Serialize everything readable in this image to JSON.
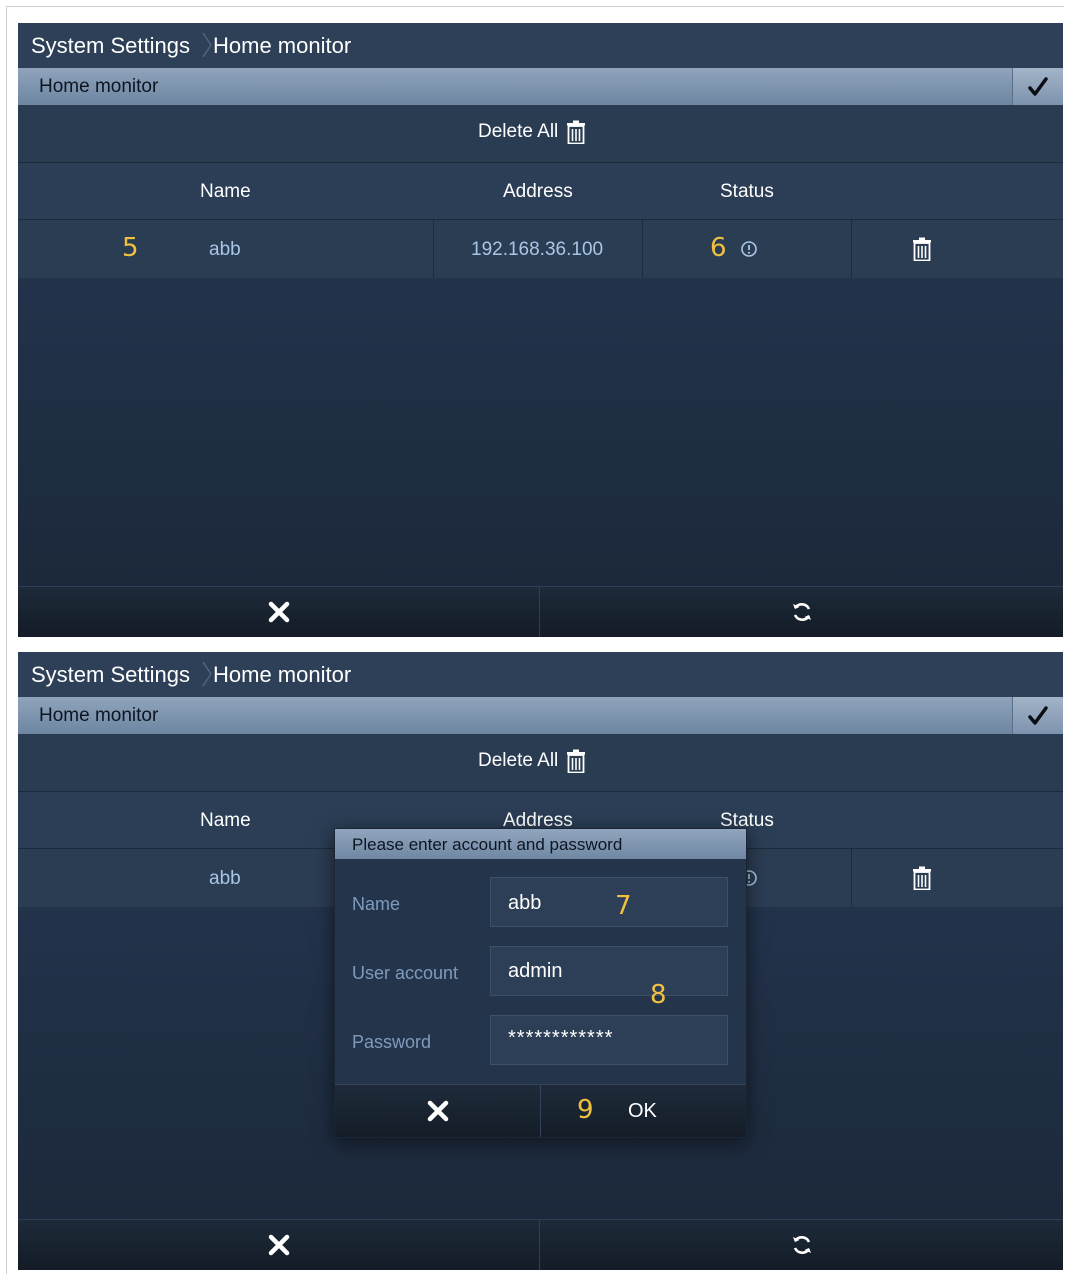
{
  "screen1": {
    "breadcrumb": {
      "root": "System Settings",
      "current": "Home monitor"
    },
    "section_title": "Home monitor",
    "delete_all_label": "Delete All",
    "columns": {
      "name": "Name",
      "address": "Address",
      "status": "Status"
    },
    "row": {
      "name": "abb",
      "address": "192.168.36.100",
      "status_icon": "info-circle-icon"
    },
    "callouts": {
      "c5": "5",
      "c6": "6"
    }
  },
  "screen2": {
    "breadcrumb": {
      "root": "System Settings",
      "current": "Home monitor"
    },
    "section_title": "Home monitor",
    "delete_all_label": "Delete All",
    "columns": {
      "name": "Name",
      "address": "Address",
      "status": "Status"
    },
    "row": {
      "name": "abb"
    },
    "dialog": {
      "title": "Please enter account and password",
      "name_label": "Name",
      "name_value": "abb",
      "account_label": "User account",
      "account_value": "admin",
      "password_label": "Password",
      "password_value": "************",
      "ok_label": "OK"
    },
    "callouts": {
      "c7": "7",
      "c8": "8",
      "c9": "9"
    }
  },
  "colors": {
    "accent_callout": "#f0c040",
    "screen_bg": "#22324a",
    "header_bar": "#7e94ae"
  }
}
